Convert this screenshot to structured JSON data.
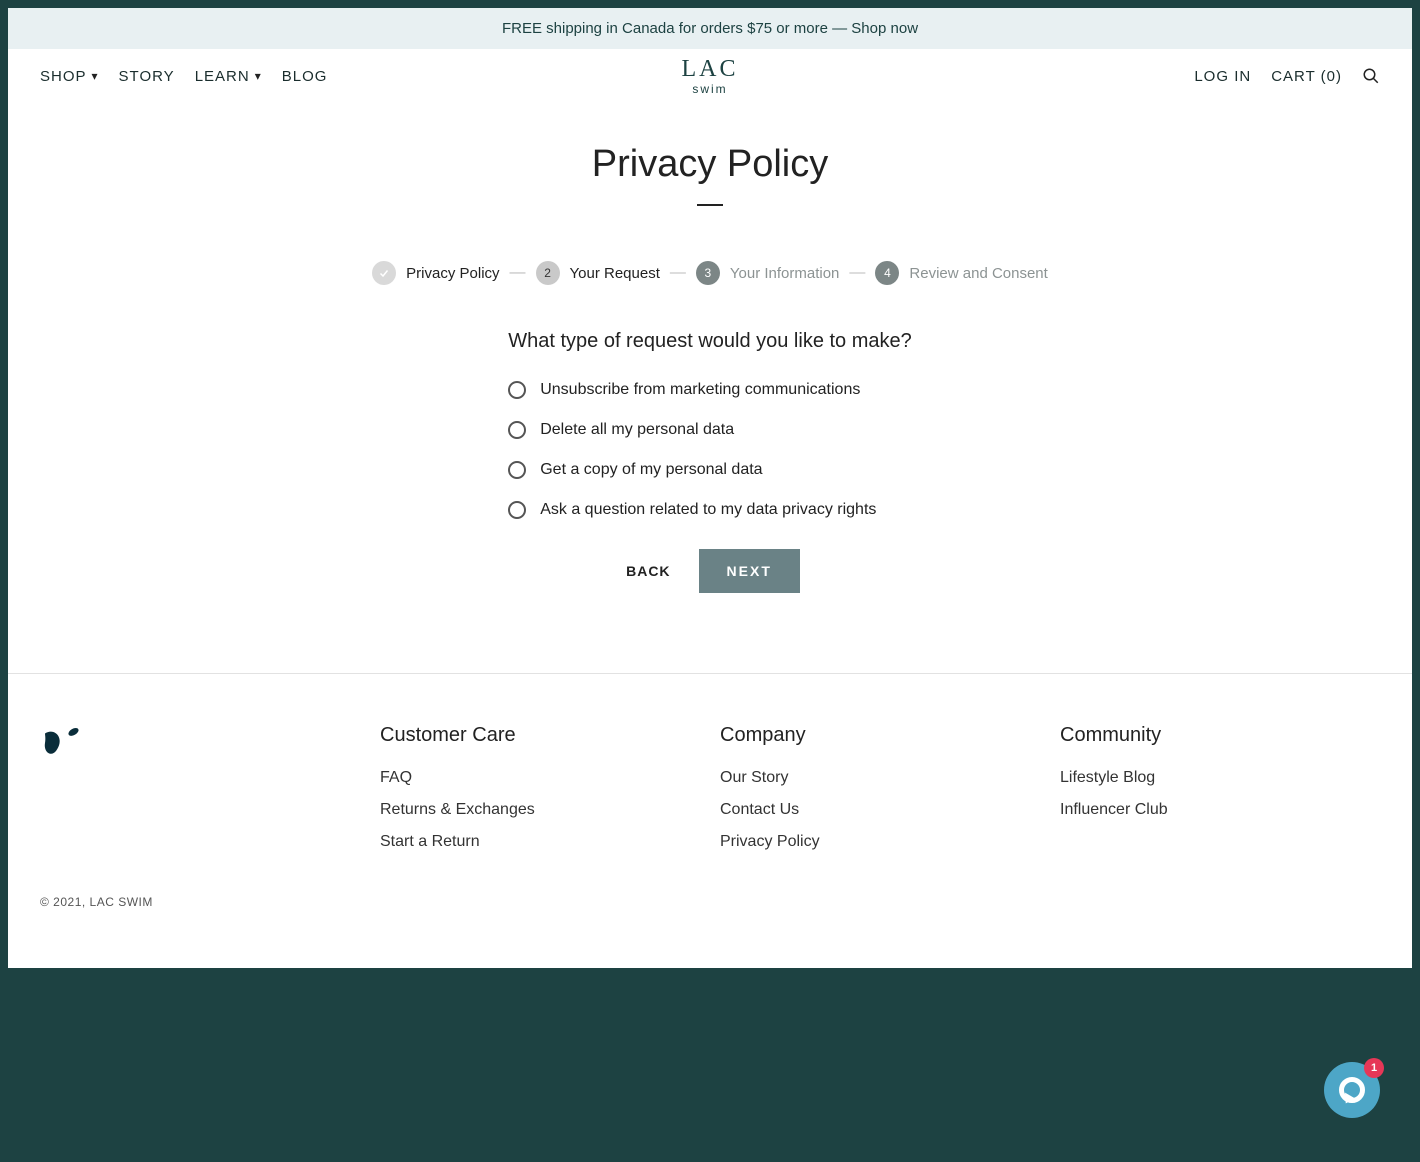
{
  "announcement": "FREE shipping in Canada for orders $75 or more — Shop now",
  "nav": {
    "shop": "SHOP",
    "story": "STORY",
    "learn": "LEARN",
    "blog": "BLOG",
    "login": "LOG IN",
    "cart": "CART (0)"
  },
  "logo": {
    "main": "LAC",
    "sub": "swim"
  },
  "page_title": "Privacy Policy",
  "steps": [
    {
      "num": "✓",
      "label": "Privacy Policy",
      "state": "done"
    },
    {
      "num": "2",
      "label": "Your Request",
      "state": "active"
    },
    {
      "num": "3",
      "label": "Your Information",
      "state": "pending"
    },
    {
      "num": "4",
      "label": "Review and Consent",
      "state": "pending"
    }
  ],
  "question": "What type of request would you like to make?",
  "options": [
    "Unsubscribe from marketing communications",
    "Delete all my personal data",
    "Get a copy of my personal data",
    "Ask a question related to my data privacy rights"
  ],
  "buttons": {
    "back": "BACK",
    "next": "NEXT"
  },
  "footer": {
    "columns": [
      {
        "title": "Customer Care",
        "links": [
          "FAQ",
          "Returns & Exchanges",
          "Start a Return"
        ]
      },
      {
        "title": "Company",
        "links": [
          "Our Story",
          "Contact Us",
          "Privacy Policy"
        ]
      },
      {
        "title": "Community",
        "links": [
          "Lifestyle Blog",
          "Influencer Club"
        ]
      }
    ]
  },
  "copyright": "© 2021, LAC SWIM",
  "chat_badge": "1"
}
